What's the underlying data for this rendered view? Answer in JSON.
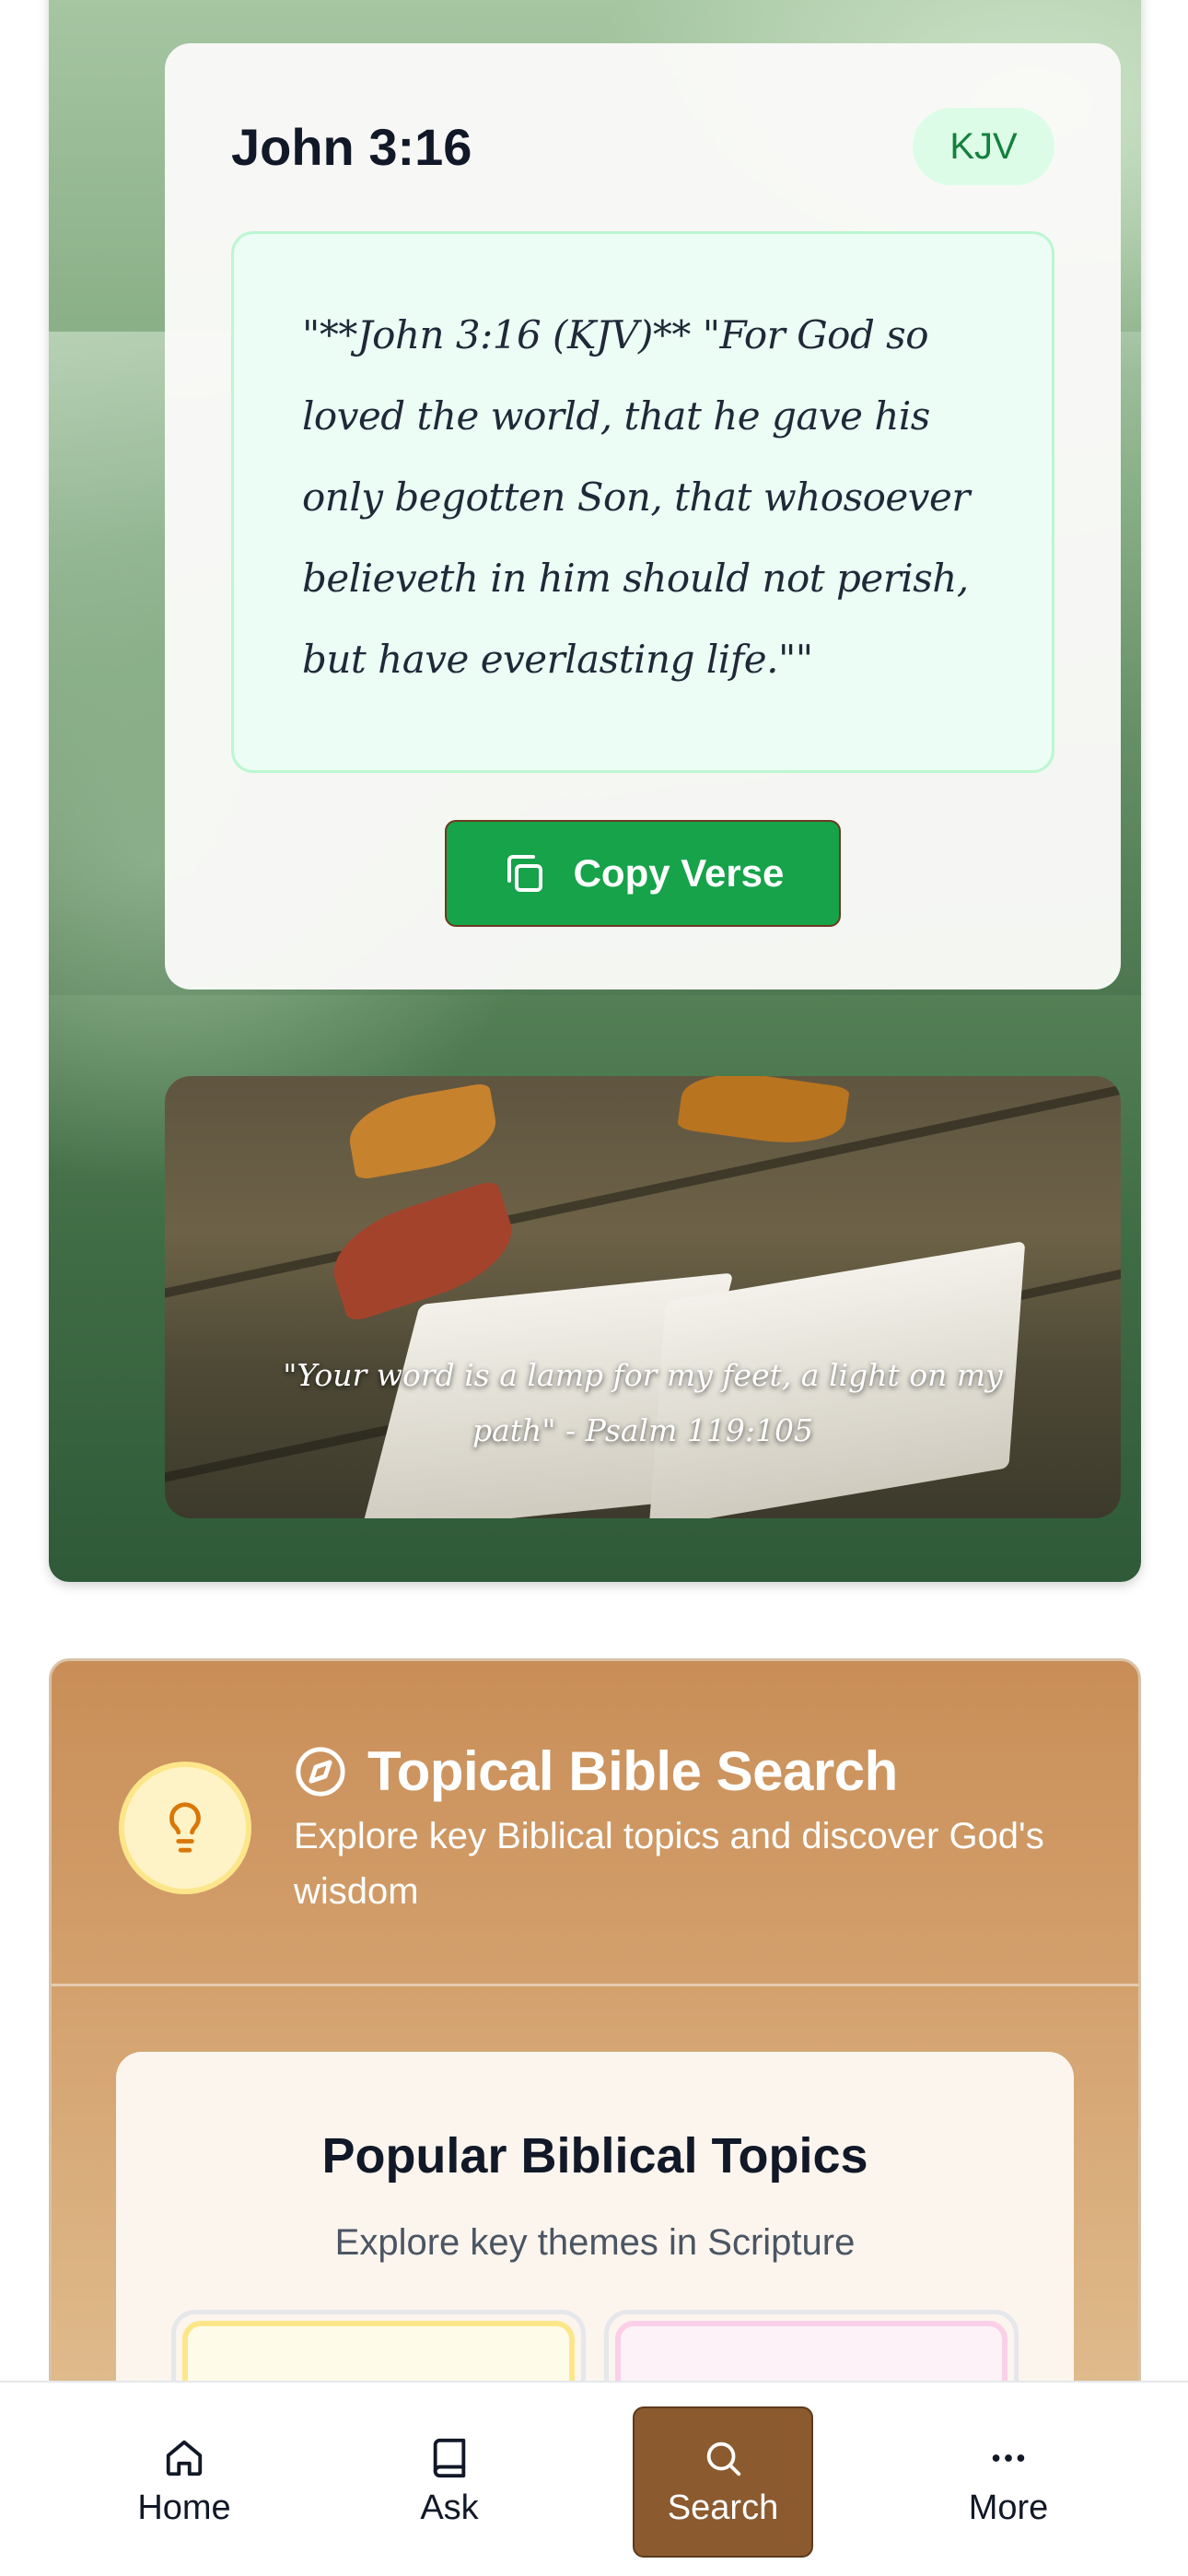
{
  "verse_card": {
    "reference": "John 3:16",
    "version_badge": "KJV",
    "verse_text": "\"**John 3:16 (KJV)** \"For God so loved the world, that he gave his only begotten Son, that whosoever believeth in him should not perish, but have everlasting life.\"\"",
    "copy_button_label": "Copy Verse"
  },
  "bible_photo": {
    "caption": "\"Your word is a lamp for my feet, a light on my path\" - Psalm 119:105"
  },
  "topical_search": {
    "title": "Topical Bible Search",
    "subtitle": "Explore key Biblical topics and discover God's wisdom",
    "popular_title": "Popular Biblical Topics",
    "popular_subtitle": "Explore key themes in Scripture"
  },
  "bottom_nav": {
    "items": [
      {
        "label": "Home",
        "icon": "home-icon"
      },
      {
        "label": "Ask",
        "icon": "book-icon"
      },
      {
        "label": "Search",
        "icon": "search-icon",
        "active": true
      },
      {
        "label": "More",
        "icon": "more-icon"
      }
    ]
  },
  "colors": {
    "primary_green": "#16a34a",
    "badge_bg": "#dcfce7",
    "nav_active": "#8b5a2f",
    "topical_bg": "#d19c68"
  }
}
